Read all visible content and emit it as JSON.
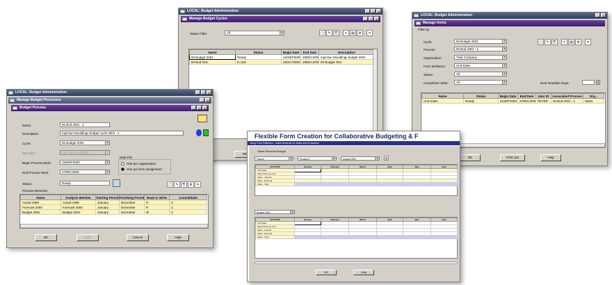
{
  "cycles_window": {
    "app_title": "LOCAL: Budget Administration",
    "title": "Manage Budget Cycles",
    "status_filter_label": "Status Filter:",
    "status_filter_value": "All",
    "columns": [
      "Name",
      "Status",
      "Begin Date",
      "End Date",
      "Description"
    ],
    "rows": [
      [
        "IM Budget 2001",
        "Ready",
        "1WSEP2000",
        "29DEC2000",
        "Injection Mouldings budget 2001"
      ],
      [
        "IM Bud Test",
        "In Use",
        "25OCT2000",
        "29DEC2000",
        "IM Budget Test"
      ]
    ],
    "ok_label": "OK"
  },
  "forms_window": {
    "app_title": "LOCAL: Budget Administration",
    "title": "Manage forms",
    "filter_by_label": "Filter by",
    "fields": [
      {
        "label": "Cycle:",
        "value": "IM Budget 2001"
      },
      {
        "label": "Process:",
        "value": "IM Bud 2001 - 1"
      },
      {
        "label": "Organization:",
        "value": "Total Company"
      },
      {
        "label": "Form Definition:",
        "value": "Unit Sales"
      },
      {
        "label": "Status:",
        "value": "All"
      },
      {
        "label": "Completion State:",
        "value": "All"
      }
    ],
    "near_deadline_label": "Near Deadline Days:",
    "columns": [
      "Name",
      "Status",
      "Begin Date",
      "End Date",
      "User ID",
      "Associated Process",
      "Org..."
    ],
    "rows": [
      [
        "Unit Sales",
        "Ready",
        "21SEP2000",
        "27DEC2000",
        "PETER",
        "IM Bud 2001 - 1",
        "Sales"
      ]
    ],
    "ok_label": "OK",
    "print_label": "Print List",
    "help_label": "Help"
  },
  "process_window": {
    "app_title": "LOCAL: Budget Administration",
    "outer_title": "Manage Budget Processes",
    "title": "Budget Process",
    "name_label": "Name:",
    "name_value": "IM Bud 2001 - 1",
    "description_label": "Description:",
    "description_value": "Injection Mouldings budget cycle 2001 - 1",
    "cycle_label": "Cycle:",
    "cycle_value": "IM Budget 2001",
    "structure_label": "Structure:",
    "structure_value": "Injection Mouldings",
    "begin_label": "Begin Process Work:",
    "begin_value": "1WSEP2000",
    "end_label": "End Process Work:",
    "end_value": "27DEC2000",
    "status_label": "Status:",
    "status_value": "Ready",
    "data_file_label": "Data File",
    "radio_one_per_org": "One per organization",
    "radio_one_per_form": "One per form assignment",
    "process_elements_label": "Process elements:",
    "columns": [
      "Name",
      "Analysis Member",
      "Starting Period",
      "Finishing Period",
      "Read or Write",
      "Consolidatio"
    ],
    "rows": [
      [
        "Actual 1999",
        "Actual 1999",
        "January",
        "December",
        "R",
        "C"
      ],
      [
        "Forecast 2000",
        "Forecast 2000",
        "January",
        "December",
        "R",
        "C"
      ],
      [
        "Budget 2001",
        "Budget 2001",
        "January",
        "December",
        "W",
        "C"
      ]
    ],
    "ok_label": "OK",
    "apply_label": "Apply",
    "cancel_label": "Cancel",
    "help_label": "Help"
  },
  "flex_window": {
    "headline": "Flexible Form Creation for Collaborative Budgeting & F",
    "subbar": "Using Form Definition - Sales Revenue for Sales and Production",
    "tab_label": "Sales Revenue Budget",
    "selector1": "France",
    "selector2": "Product 1",
    "selector3": "Actual 1999",
    "grid_columns": [
      "ACCOUNT",
      "January",
      "February",
      "March",
      "April",
      "May",
      "June"
    ],
    "grid_rows": [
      "Unit Sales",
      "Sales Price per Unit",
      "Sales - Internal",
      "Sales - External",
      "Sales - Total"
    ],
    "grid2_selector": "Budget 2001",
    "ok_label": "OK",
    "help_label": "Help"
  }
}
